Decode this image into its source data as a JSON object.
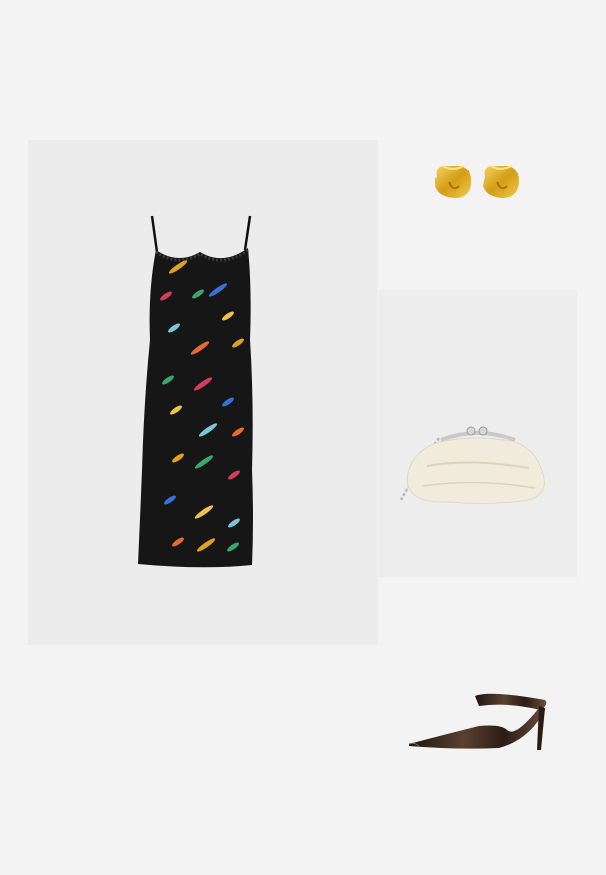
{
  "products": [
    {
      "id": "dress",
      "icon": "fish-print-slip-dress-image",
      "background": "#ececec"
    },
    {
      "id": "earrings",
      "icon": "gold-hoop-earrings-image",
      "background": "#f3f3f3"
    },
    {
      "id": "bag",
      "icon": "cream-pouch-clutch-bag-image",
      "background": "#ededed"
    },
    {
      "id": "shoe",
      "icon": "metallic-pointed-mule-heel-image",
      "background": "#f3f3f3"
    }
  ],
  "colors": {
    "page_background": "#f4f4f4",
    "dress_black": "#161616",
    "gold": "#d9a520",
    "cream": "#f1ebdc",
    "shoe_bronze": "#3a2a20"
  }
}
